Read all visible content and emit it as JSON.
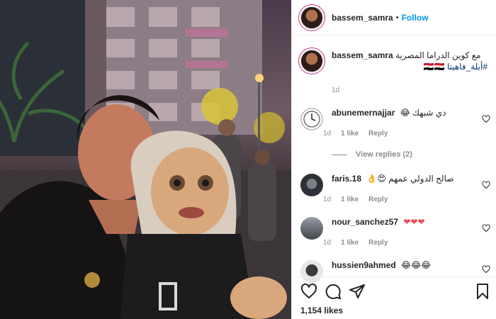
{
  "post": {
    "username": "bassem_samra",
    "follow_label": "Follow",
    "dot": "•",
    "caption_text": "مع كوين الدراما المصرية",
    "caption_tags": "#أبلة_فاهيتا 🇪🇬🇪🇬",
    "caption_time": "1d",
    "likes": "1,154 likes"
  },
  "comments": [
    {
      "username": "abunemernajjar",
      "text": "دي شبهك 😂",
      "time": "1d",
      "likes": "1 like",
      "reply_label": "Reply",
      "view_replies": "View replies (2)",
      "avatar_icon": "clock-icon"
    },
    {
      "username": "faris.18",
      "text": "صالح الدولي عمهم 😍👌",
      "time": "1d",
      "likes": "1 like",
      "reply_label": "Reply",
      "avatar_icon": "photo-avatar"
    },
    {
      "username": "nour_sanchez57",
      "text": "❤❤❤",
      "time": "1d",
      "likes": "1 like",
      "reply_label": "Reply",
      "avatar_icon": "photo-avatar"
    },
    {
      "username": "hussien9ahmed",
      "text": "😂😂😂",
      "avatar_icon": "photo-avatar"
    }
  ],
  "icons": {
    "like": "heart-icon",
    "comment": "comment-icon",
    "share": "share-icon",
    "save": "bookmark-icon"
  },
  "colors": {
    "accent": "#0095f6",
    "heart": "#ed4956",
    "muted": "#8e8e8e"
  }
}
